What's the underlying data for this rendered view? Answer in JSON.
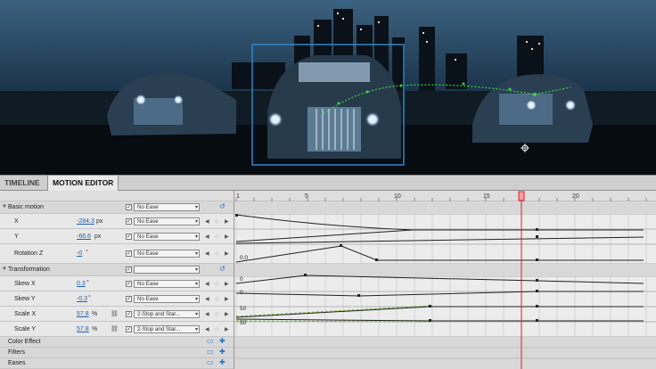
{
  "tabs": {
    "timeline": "TIMELINE",
    "motion_editor": "MOTION EDITOR"
  },
  "ruler": {
    "ticks": [
      "1",
      "5",
      "10",
      "15",
      "20"
    ],
    "playhead_frame": 17
  },
  "sections": [
    {
      "label": "Basic motion",
      "type": "group",
      "ease": "No Ease"
    },
    {
      "label": "X",
      "value": "-284.3",
      "unit": "px",
      "ease": "No Ease"
    },
    {
      "label": "Y",
      "value": "-66.6",
      "unit": "px",
      "ease": "No Ease"
    },
    {
      "label": "Rotation Z",
      "value": "-0",
      "unit": "°",
      "ease": "No Ease"
    },
    {
      "label": "Transformation",
      "type": "group",
      "ease": ""
    },
    {
      "label": "Skew X",
      "value": "0.3",
      "unit": "°",
      "ease": "No Ease"
    },
    {
      "label": "Skew Y",
      "value": "-0.3",
      "unit": "°",
      "ease": "No Ease"
    },
    {
      "label": "Scale X",
      "value": "57.8",
      "unit": "%",
      "ease": "2-Stop and Star..."
    },
    {
      "label": "Scale Y",
      "value": "57.8",
      "unit": "%",
      "ease": "2-Stop and Star..."
    },
    {
      "label": "Color Effect",
      "type": "footer"
    },
    {
      "label": "Filters",
      "type": "footer"
    },
    {
      "label": "Eases",
      "type": "footer"
    }
  ],
  "graph_labels": {
    "rotation": "0.0",
    "skew_x": "0",
    "skew_y": "0",
    "scale_x": "50",
    "scale_y": "50"
  },
  "colors": {
    "accent": "#2a6bb8",
    "playhead": "#d9202a",
    "motion_path": "#39d43a",
    "selection": "#2e88c8"
  },
  "icons": {
    "checkbox": "check-icon",
    "keyframe_prev": "left-triangle-icon",
    "keyframe_add": "diamond-icon",
    "keyframe_next": "right-triangle-icon",
    "reset": "reset-icon",
    "add": "plus-icon",
    "remove": "minus-icon",
    "link": "chain-icon"
  }
}
